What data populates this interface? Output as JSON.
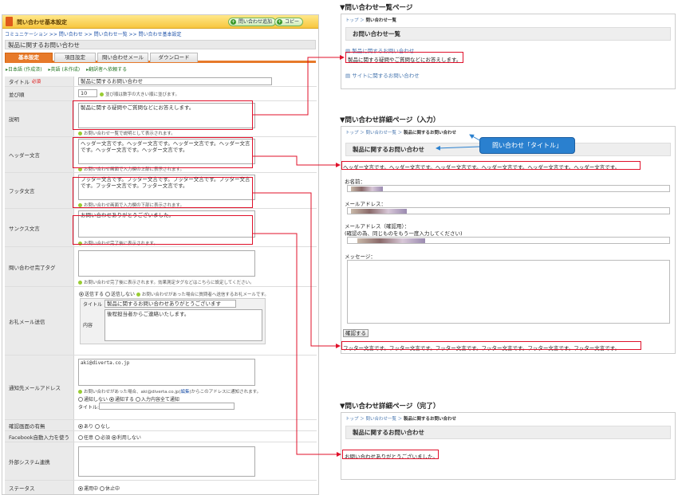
{
  "admin": {
    "window_title": "問い合わせ基本設定",
    "add_button": "問い合わせ追加",
    "copy_button": "コピー",
    "breadcrumb": "コミュニケーション >> 問い合わせ >> 問い合わせ一覧 >> 問い合わせ基本設定",
    "page_title": "製品に関するお問い合わせ",
    "tabs": [
      "基本設定",
      "項目設定",
      "問い合わせメール",
      "ダウンロード"
    ],
    "languages": [
      "日本語 (作成済)",
      "英語 (未作成)",
      "翻訳者へ依頼する"
    ],
    "rows": {
      "title": {
        "label": "タイトル",
        "required": "必須",
        "value": "製品に関するお問い合わせ"
      },
      "order": {
        "label": "並び順",
        "value": "10",
        "hint": "並び順は数字の大きい順に並びます。"
      },
      "description": {
        "label": "説明",
        "value": "製品に関する疑問やご質問などにお答えします。",
        "hint": "お問い合わせ一覧で説明として表示されます。"
      },
      "header": {
        "label": "ヘッダー文言",
        "value": "ヘッダー文言です。ヘッダー文言です。ヘッダー文言です。ヘッダー文言です。ヘッダー文言です。ヘッダー文言です。",
        "hint": "お問い合わせ画面で入力欄の上部に表示されます。"
      },
      "footer": {
        "label": "フッタ文言",
        "value": "フッター文言です。フッター文言です。フッター文言です。フッター文言です。フッター文言です。フッター文言です。",
        "hint": "お問い合わせ画面で入力欄の下部に表示されます。"
      },
      "thanks": {
        "label": "サンクス文言",
        "value": "お問い合わせありがとうございました。",
        "hint": "お問い合わせ完了後に表示されます。"
      },
      "complete_tag": {
        "label": "問い合わせ完了タグ",
        "hint": "お問い合わせ完了後に表示されます。効果測定タグなどはこちらに設定してください。"
      },
      "thank_mail": {
        "label": "お礼メール送信",
        "send": "送信する",
        "no_send": "送信しない",
        "hint": "お問い合わせがあった場合に質問者へ送信するお礼メールです。",
        "title_label": "タイトル",
        "title_value": "製品に関するお問い合わせありがとうございます",
        "body_label": "内容",
        "body_value": "後程担当者からご連絡いたします。"
      },
      "notify": {
        "label": "通知先メールアドレス",
        "value": "aki@diverta.co.jp",
        "hint_pre": "お問い合わせがあった場合、aki@diverta.co.jp(",
        "hint_link": "編集",
        "hint_post": ")からこのアドレスに通知されます。",
        "opt1": "通知しない",
        "opt2": "通知する",
        "opt3": "入力内容全て通知",
        "title_label": "タイトル:"
      },
      "confirm": {
        "label": "確認画面の有無",
        "opt1": "あり",
        "opt2": "なし"
      },
      "facebook": {
        "label": "Facebook自動入力を使う",
        "opt1": "任意",
        "opt2": "必須",
        "opt3": "利用しない"
      },
      "external": {
        "label": "外部システム連携"
      },
      "status": {
        "label": "ステータス",
        "opt1": "運用中",
        "opt2": "休止中"
      }
    }
  },
  "list_page": {
    "section_title": "▼問い合わせ一覧ページ",
    "breadcrumb_home": "トップ",
    "breadcrumb_current": "問い合わせ一覧",
    "heading": "お問い合わせ一覧",
    "item1_link": "製品に関するお問い合わせ",
    "item1_desc": "製品に関する疑問やご質問などにお答えします。",
    "item2_link": "サイトに関するお問い合わせ"
  },
  "detail_input": {
    "section_title": "▼問い合わせ詳細ページ（入力）",
    "breadcrumb_home": "トップ",
    "breadcrumb_list": "問い合わせ一覧",
    "breadcrumb_current": "製品に関するお問い合わせ",
    "heading": "製品に関するお問い合わせ",
    "callout": "問い合わせ「タイトル」",
    "header_text": "ヘッダー文言です。ヘッダー文言です。ヘッダー文言です。ヘッダー文言です。ヘッダー文言です。ヘッダー文言です。",
    "name_label": "お名前：",
    "email_label": "メールアドレス：",
    "email_confirm_label": "メールアドレス（確認用）：",
    "email_confirm_note": "(確認の為、同じものをもう一度入力してください)",
    "message_label": "メッセージ：",
    "confirm_button": "確認する",
    "footer_text": "フッター文言です。フッター文言です。フッター文言です。フッター文言です。フッター文言です。フッター文言です。"
  },
  "detail_done": {
    "section_title": "▼問い合わせ詳細ページ（完了）",
    "breadcrumb_home": "トップ",
    "breadcrumb_list": "問い合わせ一覧",
    "breadcrumb_current": "製品に関するお問い合わせ",
    "heading": "製品に関するお問い合わせ",
    "thanks_text": "お問い合わせありがとうございました。"
  },
  "colors": {
    "accent_orange": "#e77a2a",
    "highlight_red": "#e0102a",
    "callout_blue": "#2a80cf",
    "link_blue": "#4a78b0"
  }
}
